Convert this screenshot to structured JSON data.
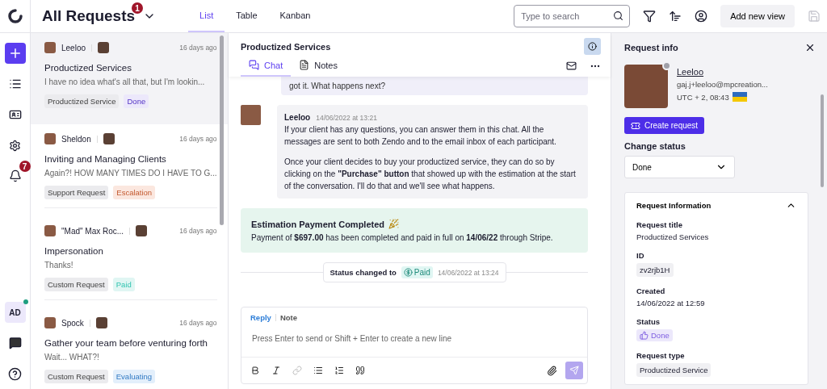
{
  "header": {
    "title": "All Requests",
    "badge": "1",
    "view_tabs": [
      {
        "label": "List",
        "selected": true
      },
      {
        "label": "Table",
        "selected": false
      },
      {
        "label": "Kanban",
        "selected": false
      }
    ],
    "search": {
      "placeholder": "Type to search"
    },
    "add_view": "Add new view"
  },
  "rail": {
    "notifications": "7",
    "user_initials": "AD",
    "user_online": true
  },
  "requests": [
    {
      "author": "Leeloo",
      "time": "16 days ago",
      "title": "Productized Services",
      "preview": "I have no idea what's all that, but I'm lookin...",
      "selected": true,
      "tags": [
        {
          "label": "Productized Service",
          "color": "#ebebee"
        },
        {
          "label": "Done",
          "color": "#ece8fb"
        }
      ]
    },
    {
      "author": "Sheldon",
      "time": "16 days ago",
      "title": "Inviting and Managing Clients",
      "preview": "Again?! HOW MANY TIMES DO I HAVE TO G...",
      "selected": false,
      "tags": [
        {
          "label": "Support Request",
          "color": "#ebebee"
        },
        {
          "label": "Escalation",
          "color": "#fbe7df"
        }
      ]
    },
    {
      "author": "\"Mad\" Max Roc...",
      "time": "16 days ago",
      "title": "Impersonation",
      "preview": "Thanks!",
      "selected": false,
      "tags": [
        {
          "label": "Custom Request",
          "color": "#ebebee"
        },
        {
          "label": "Paid",
          "color": "#e0f6f3"
        }
      ]
    },
    {
      "author": "Spock",
      "time": "16 days ago",
      "title": "Gather your team before venturing forth",
      "preview": "Wait... WHAT?!",
      "selected": false,
      "tags": [
        {
          "label": "Custom Request",
          "color": "#ebebee"
        },
        {
          "label": "Evaluating",
          "color": "#e3effb"
        }
      ]
    }
  ],
  "chat": {
    "title": "Productized Services",
    "tabs": [
      {
        "label": "Chat",
        "selected": true
      },
      {
        "label": "Notes",
        "selected": false
      }
    ],
    "earlier_message": "got it. What happens next?",
    "message": {
      "author": "Leeloo",
      "time": "14/06/2022 at 13:21",
      "paragraphs": [
        "If your client has any questions, you can answer them in this chat. All the messages are sent to both Zendo and to the email inbox of each participant.",
        "Once your client decides to buy your productized service, they can do so by clicking on the **\"Purchase\" button** that showed up with the estimation at the start of the conversation. I'll do that and we'll see what happens."
      ]
    },
    "payment": {
      "title": "Estimation Payment Completed",
      "text": "Payment of **$697.00** has been completed and paid in full on **14/06/22** through Stripe."
    },
    "status_change": {
      "label": "Status changed to",
      "status": "Paid",
      "time": "14/06/2022 at 13:24"
    },
    "composer": {
      "tabs": [
        {
          "label": "Reply",
          "selected": true
        },
        {
          "label": "Note",
          "selected": false
        }
      ],
      "placeholder": "Press Enter to send or Shift + Enter to create a new line"
    }
  },
  "info": {
    "title": "Request info",
    "contact": {
      "name": "Leeloo",
      "email": "gaj.j+leeloo@mpcreation...",
      "time": "UTC + 2, 08:43"
    },
    "create_button": "Create request",
    "change_status_label": "Change status",
    "status_value": "Done",
    "section": {
      "title": "Request Information",
      "expanded": true,
      "fields": [
        {
          "label": "Request title",
          "value": "Productized Services",
          "kind": "text"
        },
        {
          "label": "ID",
          "value": "zv2rjb1H",
          "kind": "chip"
        },
        {
          "label": "Created",
          "value": "14/06/2022 at 12:59",
          "kind": "text"
        },
        {
          "label": "Status",
          "value": "Done",
          "kind": "status"
        },
        {
          "label": "Request type",
          "value": "Productized Service",
          "kind": "chip"
        }
      ]
    }
  }
}
